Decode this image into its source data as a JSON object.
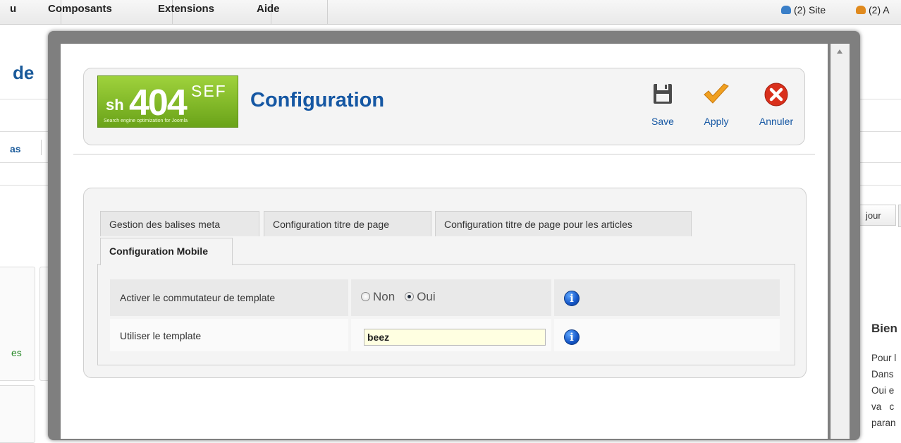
{
  "background": {
    "menu": [
      "u",
      "Composants",
      "Extensions",
      "Aide"
    ],
    "status": {
      "site": "(2) Site",
      "admin": "(2) A"
    },
    "title_fragment": "de",
    "tab_fragment": "as",
    "green_fragment": "es",
    "update_button": "jour",
    "welcome_title": "Bien",
    "welcome_lines": [
      "Pour l",
      "Dans",
      "Oui e",
      "va   c",
      "paran"
    ]
  },
  "logo": {
    "sh": "sh",
    "num": "404",
    "sef": "SEF",
    "tagline": "Search engine optimization for Joomla"
  },
  "page_title": "Configuration",
  "toolbar": {
    "save_label": "Save",
    "apply_label": "Apply",
    "cancel_label": "Annuler"
  },
  "tabs": [
    {
      "label": "Gestion des balises meta",
      "active": false
    },
    {
      "label": "Configuration titre de page",
      "active": false
    },
    {
      "label": "Configuration titre de page pour les articles",
      "active": false
    },
    {
      "label": "Configuration Mobile",
      "active": true
    }
  ],
  "form": {
    "rows": [
      {
        "label": "Activer le commutateur de template",
        "options": [
          {
            "label": "Non",
            "checked": false
          },
          {
            "label": "Oui",
            "checked": true
          }
        ]
      },
      {
        "label": "Utiliser le template",
        "value": "beez"
      }
    ]
  },
  "colors": {
    "accent": "#1557a3",
    "logo_green": "#7cb82a",
    "input_bg": "#ffffe1",
    "cancel_red": "#d9301c",
    "apply_orange": "#f0a020"
  }
}
